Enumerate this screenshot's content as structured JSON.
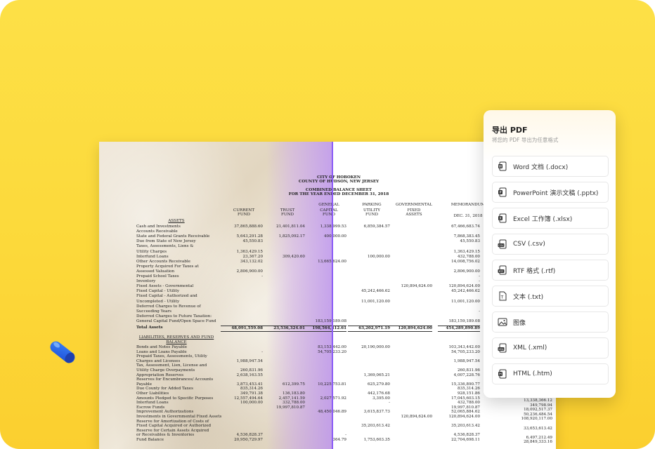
{
  "panel": {
    "title": "导出 PDF",
    "subtitle": "将您的 PDF 导出为任意格式",
    "options": [
      {
        "label": "Word 文档 (.docx)",
        "icon": "word-icon"
      },
      {
        "label": "PowerPoint 演示文稿 (.pptx)",
        "icon": "powerpoint-icon"
      },
      {
        "label": "Excel 工作簿 (.xlsx)",
        "icon": "excel-icon"
      },
      {
        "label": "CSV (.csv)",
        "icon": "csv-icon"
      },
      {
        "label": "RTF 格式 (.rtf)",
        "icon": "rtf-icon"
      },
      {
        "label": "文本 (.txt)",
        "icon": "text-icon"
      },
      {
        "label": "图像",
        "icon": "image-icon"
      },
      {
        "label": "XML (.xml)",
        "icon": "xml-icon"
      },
      {
        "label": "HTML (.htm)",
        "icon": "html-icon"
      }
    ]
  },
  "doc": {
    "title1": "CITY OF HOBOKEN",
    "title2": "COUNTY OF HUDSON, NEW JERSEY",
    "title3": "COMBINED BALANCE SHEET",
    "title4": "FOR THE YEAR ENDED DECEMBER 31, 2018",
    "headers": {
      "current": [
        "CURRENT",
        "FUND"
      ],
      "trust": [
        "TRUST",
        "FUND"
      ],
      "general": [
        "GENERAL",
        "CAPITAL",
        "FUND"
      ],
      "parking": [
        "PARKING",
        "UTILITY",
        "FUND"
      ],
      "governmental": [
        "GOVERNMENTAL",
        "FIXED",
        "ASSETS"
      ],
      "memorandum": [
        "MEMORANDUM",
        "DEC. 31, 2018"
      ]
    },
    "assets_heading": "ASSETS",
    "rows": [
      {
        "label": "Cash and Investments",
        "cur": "37,865,888.60",
        "trust": "21,401,811.04",
        "gen": "1,338,999.53",
        "park": "6,859,384.57",
        "gov": "",
        "memo": "67,466,683.74",
        "dollar": true
      },
      {
        "label": "Accounts Receivable",
        "cur": "",
        "trust": "",
        "gen": "",
        "park": "",
        "gov": "",
        "memo": ""
      },
      {
        "label": "  State and Federal Grants Receivable",
        "cur": "5,643,291.28",
        "trust": "1,825,092.17",
        "gen": "400,000.00",
        "park": "",
        "gov": "",
        "memo": "7,868,383.45"
      },
      {
        "label": "  Due from State of New Jersey",
        "cur": "45,550.83",
        "trust": "",
        "gen": "",
        "park": "",
        "gov": "",
        "memo": "45,550.83"
      },
      {
        "label": "  Taxes, Assessments, Liens &",
        "cur": "",
        "trust": "",
        "gen": "",
        "park": "",
        "gov": "",
        "memo": ""
      },
      {
        "label": "    Utility Charges",
        "cur": "1,363,429.15",
        "trust": "",
        "gen": "",
        "park": "",
        "gov": "",
        "memo": "1,363,429.15"
      },
      {
        "label": "  Interfund Loans",
        "cur": "23,367.20",
        "trust": "309,420.60",
        "gen": "",
        "park": "100,000.00",
        "gov": "",
        "memo": "432,788.00"
      },
      {
        "label": "  Other Accounts Receivable",
        "cur": "343,132.02",
        "trust": "",
        "gen": "13,665,624.00",
        "park": "",
        "gov": "",
        "memo": "14,008,756.02"
      },
      {
        "label": "Property Acquired For Taxes at",
        "cur": "",
        "trust": "",
        "gen": "",
        "park": "",
        "gov": "",
        "memo": ""
      },
      {
        "label": "  Assessed Valuation",
        "cur": "2,806,900.00",
        "trust": "",
        "gen": "",
        "park": "",
        "gov": "",
        "memo": "2,806,900.00"
      },
      {
        "label": "Prepaid School Taxes",
        "cur": "-",
        "trust": "",
        "gen": "",
        "park": "",
        "gov": "",
        "memo": "-"
      },
      {
        "label": "Inventory",
        "cur": "",
        "trust": "",
        "gen": "",
        "park": "",
        "gov": "",
        "memo": "-"
      },
      {
        "label": "Fixed Assets - Governmental",
        "cur": "",
        "trust": "",
        "gen": "",
        "park": "",
        "gov": "120,894,624.00",
        "memo": "120,894,624.00"
      },
      {
        "label": "Fixed Capital - Utility",
        "cur": "",
        "trust": "",
        "gen": "",
        "park": "45,242,466.62",
        "gov": "",
        "memo": "45,242,466.62"
      },
      {
        "label": "Fixed Capital - Authorized and",
        "cur": "",
        "trust": "",
        "gen": "",
        "park": "",
        "gov": "",
        "memo": ""
      },
      {
        "label": "  Uncompleted - Utility",
        "cur": "",
        "trust": "",
        "gen": "",
        "park": "11,001,120.00",
        "gov": "",
        "memo": "11,001,120.00"
      },
      {
        "label": "Deferred Charges to Revenue of",
        "cur": "",
        "trust": "",
        "gen": "",
        "park": "",
        "gov": "",
        "memo": ""
      },
      {
        "label": "  Succeeding Years",
        "cur": "",
        "trust": "",
        "gen": "",
        "park": "",
        "gov": "",
        "memo": "-"
      },
      {
        "label": "Deferred Charges to Future Taxation:",
        "cur": "",
        "trust": "",
        "gen": "",
        "park": "",
        "gov": "",
        "memo": ""
      },
      {
        "label": "  General Capital Fund/Open Space Fund",
        "cur": "",
        "trust": "",
        "gen": "183,159,189.08",
        "park": "",
        "gov": "",
        "memo": "183,159,189.08"
      }
    ],
    "total_assets": {
      "label": "Total Assets",
      "cur": "48,091,559.08",
      "trust": "23,536,324.01",
      "gen": "198,564,412.61",
      "park": "63,202,971.19",
      "gov": "120,894,624.00",
      "memo": "454,289,890.89"
    },
    "liab_heading1": "LIABILITIES, RESERVES AND FUND",
    "liab_heading2": "BALANCE",
    "liab_rows": [
      {
        "label": "Bonds and Notes Payable",
        "cur": "",
        "trust": "",
        "gen": "83,153,442.00",
        "park": "20,190,000.00",
        "gov": "",
        "memo": "103,343,442.00",
        "dollar": true
      },
      {
        "label": "Loans and Loans Payable",
        "cur": "-",
        "trust": "",
        "gen": "54,705,233.20",
        "park": "",
        "gov": "",
        "memo": "54,705,233.20"
      },
      {
        "label": "Prepaid Taxes, Assessments, Utility",
        "cur": "",
        "trust": "",
        "gen": "",
        "park": "",
        "gov": "",
        "memo": ""
      },
      {
        "label": "  Charges and Licenses",
        "cur": "1,988,947.54",
        "trust": "",
        "gen": "",
        "park": "",
        "gov": "",
        "memo": "1,988,947.54"
      },
      {
        "label": "Tax, Assessment, Lien, License and",
        "cur": "",
        "trust": "",
        "gen": "",
        "park": "",
        "gov": "",
        "memo": ""
      },
      {
        "label": "  Utility Charge Overpayments",
        "cur": "260,831.96",
        "trust": "",
        "gen": "",
        "park": "",
        "gov": "",
        "memo": "260,831.96"
      },
      {
        "label": "Appropriation Reserves",
        "cur": "2,638,163.55",
        "trust": "",
        "gen": "",
        "park": "1,369,065.21",
        "gov": "",
        "memo": "4,007,228.76"
      },
      {
        "label": "Reserves for Encumbrances/ Accounts",
        "cur": "",
        "trust": "",
        "gen": "",
        "park": "",
        "gov": "",
        "memo": ""
      },
      {
        "label": "  Payable",
        "cur": "3,873,453.41",
        "trust": "612,399.75",
        "gen": "10,225,753.81",
        "park": "625,279.80",
        "gov": "",
        "memo": "15,336,890.77"
      },
      {
        "label": "Due County for Added Taxes",
        "cur": "835,314.26",
        "trust": "",
        "gen": "",
        "park": "",
        "gov": "",
        "memo": "835,314.26"
      },
      {
        "label": "Other Liabilities",
        "cur": "349,791.38",
        "trust": "136,183.80",
        "gen": "",
        "park": "442,176.68",
        "gov": "",
        "memo": "928,151.86"
      },
      {
        "label": "Amounts Pledged to Specific Purposes",
        "cur": "12,557,494.64",
        "trust": "2,457,141.59",
        "gen": "2,027,571.92",
        "park": "3,395.00",
        "gov": "",
        "memo": "17,045,603.15"
      },
      {
        "label": "Interfund Loans",
        "cur": "100,000.00",
        "trust": "332,788.00",
        "gen": "",
        "park": "-",
        "gov": "",
        "memo": "432,788.00"
      },
      {
        "label": "Escrow Funds",
        "cur": "",
        "trust": "19,997,810.87",
        "gen": "",
        "park": "",
        "gov": "",
        "memo": "19,997,810.87"
      },
      {
        "label": "Improvement Authorizations",
        "cur": "",
        "trust": "",
        "gen": "48,450,046.89",
        "park": "3,615,837.73",
        "gov": "",
        "memo": "52,065,884.62"
      },
      {
        "label": "Investments in Governmental Fixed Assets",
        "cur": "",
        "trust": "",
        "gen": "",
        "park": "",
        "gov": "120,894,624.00",
        "memo": "120,894,624.00"
      },
      {
        "label": "Reserve for Amortization of Costs of",
        "cur": "",
        "trust": "",
        "gen": "",
        "park": "",
        "gov": "",
        "memo": ""
      },
      {
        "label": "  Fixed Capital Acquired or Authorized",
        "cur": "",
        "trust": "",
        "gen": "",
        "park": "35,203,613.42",
        "gov": "",
        "memo": "35,203,613.42"
      },
      {
        "label": "Reserve for Certain Assets Acquired",
        "cur": "",
        "trust": "",
        "gen": "",
        "park": "",
        "gov": "",
        "memo": ""
      },
      {
        "label": "  or Receivables & Inventories",
        "cur": "4,536,828.37",
        "trust": "",
        "gen": "-",
        "park": "",
        "gov": "",
        "memo": "4,536,828.37"
      },
      {
        "label": "Fund Balance",
        "cur": "20,950,729.97",
        "trust": "",
        "gen": "364.79",
        "park": "1,753,603.35",
        "gov": "",
        "memo": "22,704,698.11"
      }
    ],
    "extra_col": [
      "13,338,366.12",
      "349,798.94",
      "18,092,517.37",
      "50,236,484.54",
      "108,920,117.00",
      "",
      "33,653,613.42",
      "",
      "6,497,212.49",
      "28,849,333.16"
    ]
  }
}
